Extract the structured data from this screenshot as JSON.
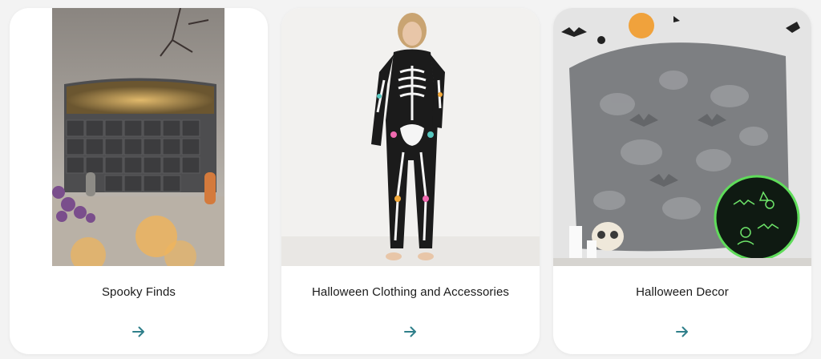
{
  "cards": [
    {
      "title": "Spooky Finds",
      "image_subject": "halloween advent calendar with bats and mice figurines",
      "arrow_icon": "arrow-right-icon"
    },
    {
      "title": "Halloween Clothing and Accessories",
      "image_subject": "woman in skeleton print pajama jumpsuit",
      "arrow_icon": "arrow-right-icon"
    },
    {
      "title": "Halloween Decor",
      "image_subject": "grey glow-in-the-dark halloween throw blanket with skull and candles",
      "arrow_icon": "arrow-right-icon"
    }
  ],
  "colors": {
    "arrow": "#2f7f8a",
    "card_bg": "#ffffff",
    "page_bg": "#f3f3f3"
  }
}
